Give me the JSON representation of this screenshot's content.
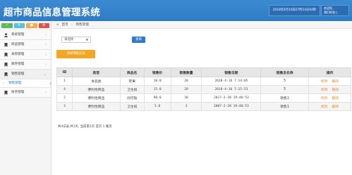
{
  "header": {
    "title": "超市商品信息管理系统",
    "datetime": "2018年4月16日07时14分54秒",
    "welcome_line1": "欢迎您 ,",
    "welcome_line2": "我们的张三"
  },
  "shortcut_colors": [
    "#5cb85c",
    "#5bc0de",
    "#f0ad4e",
    "#d9534f"
  ],
  "sidebar": {
    "items": [
      {
        "label": "系统管理",
        "icon": "user-icon"
      },
      {
        "label": "商品管理",
        "icon": "bookmark-icon"
      },
      {
        "label": "采购管理",
        "icon": "bookmark-icon"
      },
      {
        "label": "库存管理",
        "icon": "bookmark-icon"
      },
      {
        "label": "销售管理",
        "icon": "bookmark-icon"
      },
      {
        "label": "财务管理",
        "icon": "bookmark-icon"
      }
    ],
    "sub_items": [
      {
        "label": "销售管理"
      }
    ]
  },
  "breadcrumb": {
    "home": "首页",
    "current": "销售管理"
  },
  "search": {
    "select_value": "请选择",
    "button_label": "查询"
  },
  "toolbar": {
    "add_label": "添加销售记录"
  },
  "table": {
    "columns": [
      "ID",
      "类型",
      "商品名",
      "销售价",
      "销售数量",
      "销售日期",
      "销售员名称",
      "操作"
    ],
    "rows": [
      {
        "id": "1",
        "type": "食品类",
        "name": "苹果",
        "price": "10.0",
        "qty": "20",
        "date": "2018-4-16 7:14:05",
        "seller": "5"
      },
      {
        "id": "4",
        "type": "便利性商品",
        "name": "卫生纸",
        "price": "15.0",
        "qty": "20",
        "date": "2018-4-16 7:15:53",
        "seller": "5"
      },
      {
        "id": "2",
        "type": "便利性商品",
        "name": "创可贴",
        "price": "90.0",
        "qty": "30",
        "date": "2017-2-28 19:40:53",
        "seller": "销售2"
      },
      {
        "id": "3",
        "type": "便利性商品",
        "name": "卫生纸",
        "price": "5.0",
        "qty": "3",
        "date": "2007-2-28 19:40:53",
        "seller": "销售1"
      }
    ],
    "edit_label": "修改",
    "delete_label": "删除"
  },
  "pager": {
    "text": "共4记录,共1页, 当前第1页 首页 1 尾页"
  }
}
